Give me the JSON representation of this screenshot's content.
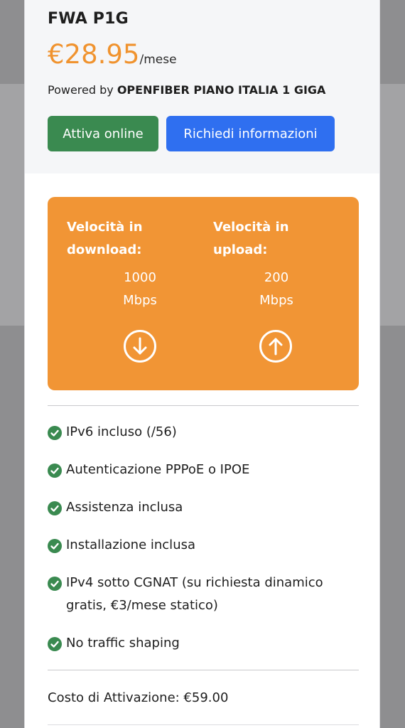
{
  "plan": {
    "title": "FWA P1G",
    "price": "€28.95",
    "price_unit": "/mese",
    "powered_prefix": "Powered by",
    "provider": "OPENFIBER PIANO ITALIA 1 GIGA"
  },
  "actions": {
    "activate_label": "Attiva online",
    "info_label": "Richiedi informazioni"
  },
  "speeds": {
    "download": {
      "label": "Velocità in download:",
      "value": "1000",
      "unit": "Mbps",
      "icon": "arrow-down-circle-icon"
    },
    "upload": {
      "label": "Velocità in upload:",
      "value": "200",
      "unit": "Mbps",
      "icon": "arrow-up-circle-icon"
    }
  },
  "features": [
    {
      "text": "IPv6 incluso (/56)",
      "icon": "check-circle-icon"
    },
    {
      "text": "Autenticazione PPPoE o IPOE",
      "icon": "check-circle-icon"
    },
    {
      "text": "Assistenza inclusa",
      "icon": "check-circle-icon"
    },
    {
      "text": "Installazione inclusa",
      "icon": "check-circle-icon"
    },
    {
      "text": "IPv4 sotto CGNAT (su richiesta dinamico gratis, €3/mese statico)",
      "icon": "check-circle-icon"
    },
    {
      "text": "No traffic shaping",
      "icon": "check-circle-icon"
    }
  ],
  "activation_cost": "Costo di Attivazione: €59.00",
  "colors": {
    "price": "#f0932f",
    "speed_box": "#f19535",
    "activate_button": "#3a8a50",
    "info_button": "#2f6ff0",
    "check": "#3a8a50"
  }
}
